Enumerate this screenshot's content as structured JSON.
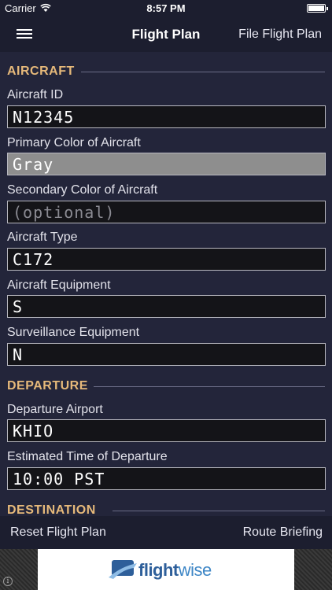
{
  "status_bar": {
    "carrier": "Carrier",
    "time": "8:57 PM"
  },
  "nav": {
    "title": "Flight Plan",
    "file_button": "File Flight Plan"
  },
  "sections": {
    "aircraft": "AIRCRAFT",
    "departure": "DEPARTURE",
    "destination": "DESTINATION"
  },
  "fields": {
    "aircraft_id": {
      "label": "Aircraft ID",
      "value": "N12345"
    },
    "primary_color": {
      "label": "Primary Color of Aircraft",
      "value": "Gray"
    },
    "secondary_color": {
      "label": "Secondary Color of Aircraft",
      "placeholder": "(optional)"
    },
    "aircraft_type": {
      "label": "Aircraft Type",
      "value": "C172"
    },
    "aircraft_equipment": {
      "label": "Aircraft Equipment",
      "value": "S"
    },
    "surveillance_equipment": {
      "label": "Surveillance Equipment",
      "value": "N"
    },
    "departure_airport": {
      "label": "Departure Airport",
      "value": "KHIO"
    },
    "departure_time": {
      "label": "Estimated Time of Departure",
      "value": "10:00 PST"
    }
  },
  "bottom_bar": {
    "reset_button": "Reset Flight Plan",
    "route_button": "Route Briefing"
  },
  "ad": {
    "brand_bold": "flight",
    "brand_light": "wise"
  },
  "icons": {
    "menu": "hamburger-menu-icon",
    "wifi": "wifi-icon",
    "battery": "battery-icon",
    "info": "info-icon",
    "logo": "flightwise-logo-icon"
  },
  "colors": {
    "background": "#23253a",
    "bar": "#1c1e2f",
    "section_accent": "#e6b97a",
    "input_background": "#141418",
    "highlight_input": "#8e8e8e",
    "brand_blue": "#2e5f9a"
  }
}
